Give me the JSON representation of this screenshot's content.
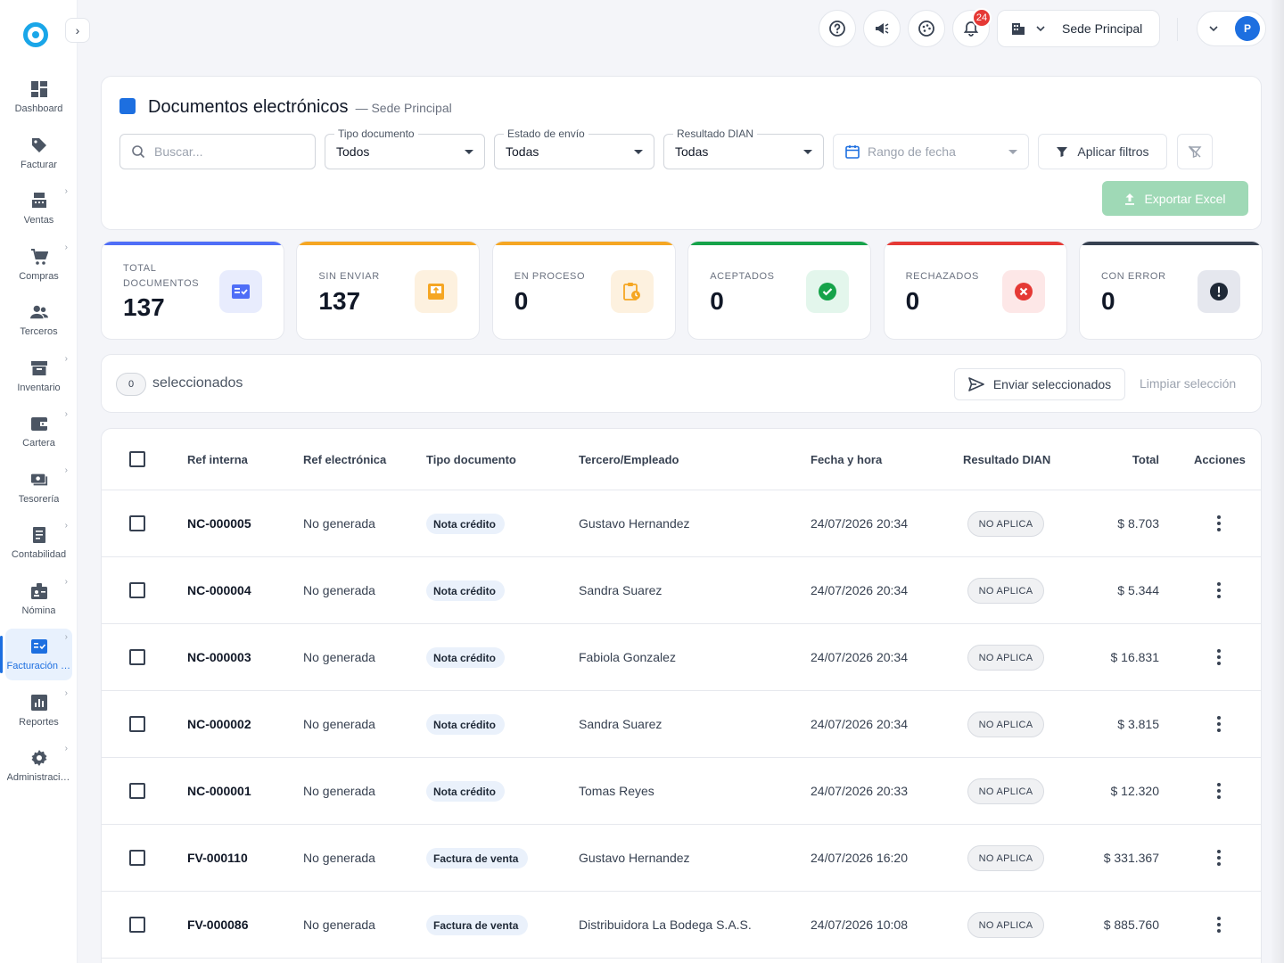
{
  "sidebar": {
    "items": [
      {
        "label": "Dashboard",
        "icon": "dashboard-icon",
        "chevron": false
      },
      {
        "label": "Facturar",
        "icon": "tag-icon",
        "chevron": false
      },
      {
        "label": "Ventas",
        "icon": "cash-register-icon",
        "chevron": true
      },
      {
        "label": "Compras",
        "icon": "cart-icon",
        "chevron": true
      },
      {
        "label": "Terceros",
        "icon": "people-icon",
        "chevron": false
      },
      {
        "label": "Inventario",
        "icon": "archive-icon",
        "chevron": true
      },
      {
        "label": "Cartera",
        "icon": "wallet-icon",
        "chevron": true
      },
      {
        "label": "Tesorería",
        "icon": "money-icon",
        "chevron": true
      },
      {
        "label": "Contabilidad",
        "icon": "ledger-icon",
        "chevron": true
      },
      {
        "label": "Nómina",
        "icon": "badge-icon",
        "chevron": true
      },
      {
        "label": "Facturación electrónica",
        "icon": "e-invoice-icon",
        "chevron": true,
        "active": true
      },
      {
        "label": "Reportes",
        "icon": "chart-icon",
        "chevron": true
      },
      {
        "label": "Administración",
        "icon": "gear-icon",
        "chevron": true
      }
    ]
  },
  "topbar": {
    "notifications": "24",
    "sede": "Sede Principal",
    "avatar": "P"
  },
  "header": {
    "title": "Documentos electrónicos",
    "subtitle": "— Sede Principal"
  },
  "filters": {
    "search_placeholder": "Buscar...",
    "tipo_label": "Tipo documento",
    "tipo_value": "Todos",
    "estado_label": "Estado de envío",
    "estado_value": "Todas",
    "resultado_label": "Resultado DIAN",
    "resultado_value": "Todas",
    "fecha_placeholder": "Rango de fecha",
    "apply_label": "Aplicar filtros",
    "export_label": "Exportar Excel"
  },
  "stats": [
    {
      "label": "TOTAL DOCUMENTOS",
      "value": "137",
      "color": "#4f6ef7",
      "bg": "#e8ecfd"
    },
    {
      "label": "SIN ENVIAR",
      "value": "137",
      "color": "#f5a623",
      "bg": "#fdf1df"
    },
    {
      "label": "EN PROCESO",
      "value": "0",
      "color": "#f5a623",
      "bg": "#fdf1df"
    },
    {
      "label": "ACEPTADOS",
      "value": "0",
      "color": "#16a34a",
      "bg": "#e3f6ec"
    },
    {
      "label": "RECHAZADOS",
      "value": "0",
      "color": "#e53935",
      "bg": "#fde7e7"
    },
    {
      "label": "CON ERROR",
      "value": "0",
      "color": "#374151",
      "bg": "#e5e7ee"
    }
  ],
  "selection": {
    "count": "0",
    "label": "seleccionados",
    "send_label": "Enviar seleccionados",
    "clear_label": "Limpiar selección"
  },
  "table": {
    "columns": [
      "Ref interna",
      "Ref electrónica",
      "Tipo documento",
      "Tercero/Empleado",
      "Fecha y hora",
      "Resultado DIAN",
      "Total",
      "Acciones"
    ],
    "rows": [
      {
        "ref": "NC-000005",
        "ref_e": "No generada",
        "tipo": "Nota crédito",
        "tercero": "Gustavo Hernandez",
        "fecha": "24/07/2026 20:34",
        "dian": "NO APLICA",
        "total": "$ 8.703"
      },
      {
        "ref": "NC-000004",
        "ref_e": "No generada",
        "tipo": "Nota crédito",
        "tercero": "Sandra Suarez",
        "fecha": "24/07/2026 20:34",
        "dian": "NO APLICA",
        "total": "$ 5.344"
      },
      {
        "ref": "NC-000003",
        "ref_e": "No generada",
        "tipo": "Nota crédito",
        "tercero": "Fabiola Gonzalez",
        "fecha": "24/07/2026 20:34",
        "dian": "NO APLICA",
        "total": "$ 16.831"
      },
      {
        "ref": "NC-000002",
        "ref_e": "No generada",
        "tipo": "Nota crédito",
        "tercero": "Sandra Suarez",
        "fecha": "24/07/2026 20:34",
        "dian": "NO APLICA",
        "total": "$ 3.815"
      },
      {
        "ref": "NC-000001",
        "ref_e": "No generada",
        "tipo": "Nota crédito",
        "tercero": "Tomas Reyes",
        "fecha": "24/07/2026 20:33",
        "dian": "NO APLICA",
        "total": "$ 12.320"
      },
      {
        "ref": "FV-000110",
        "ref_e": "No generada",
        "tipo": "Factura de venta",
        "tercero": "Gustavo Hernandez",
        "fecha": "24/07/2026 16:20",
        "dian": "NO APLICA",
        "total": "$ 331.367"
      },
      {
        "ref": "FV-000086",
        "ref_e": "No generada",
        "tipo": "Factura de venta",
        "tercero": "Distribuidora La Bodega S.A.S.",
        "fecha": "24/07/2026 10:08",
        "dian": "NO APLICA",
        "total": "$ 885.760"
      }
    ]
  }
}
